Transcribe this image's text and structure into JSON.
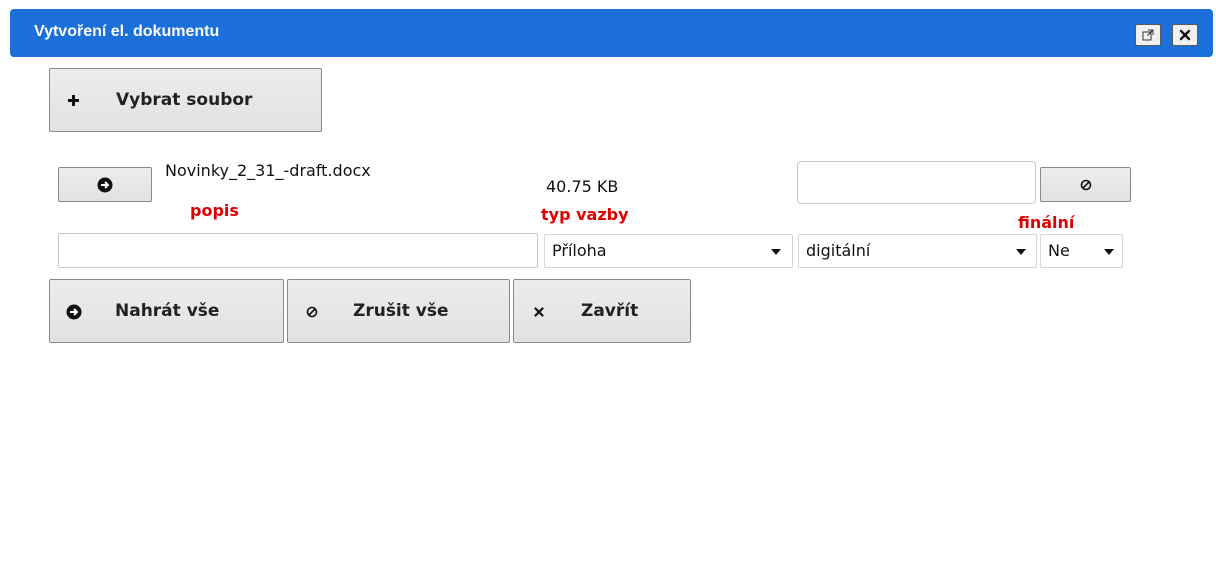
{
  "dialog": {
    "title": "Vytvoření el. dokumentu",
    "popout_icon": "popout-icon",
    "close_icon": "close-icon",
    "accent_color": "#1a6fd8"
  },
  "select_file_button": {
    "label": "Vybrat soubor",
    "icon": "plus-icon"
  },
  "file": {
    "name": "Novinky_2_31_-draft.docx",
    "size": "40.75 KB",
    "upload_icon": "arrow-circle-right-icon",
    "cancel_icon": "cancel-icon"
  },
  "labels": {
    "popis": "popis",
    "typ_vazby": "typ vazby",
    "finalni": "finální",
    "label_color": "#e00000"
  },
  "fields": {
    "popis_value": "",
    "extra_value": "",
    "typ_vazby_selected": "Příloha",
    "forma_selected": "digitální",
    "finalni_selected": "Ne"
  },
  "actions": {
    "upload_all": "Nahrát vše",
    "cancel_all": "Zrušit vše",
    "close": "Zavřít"
  }
}
